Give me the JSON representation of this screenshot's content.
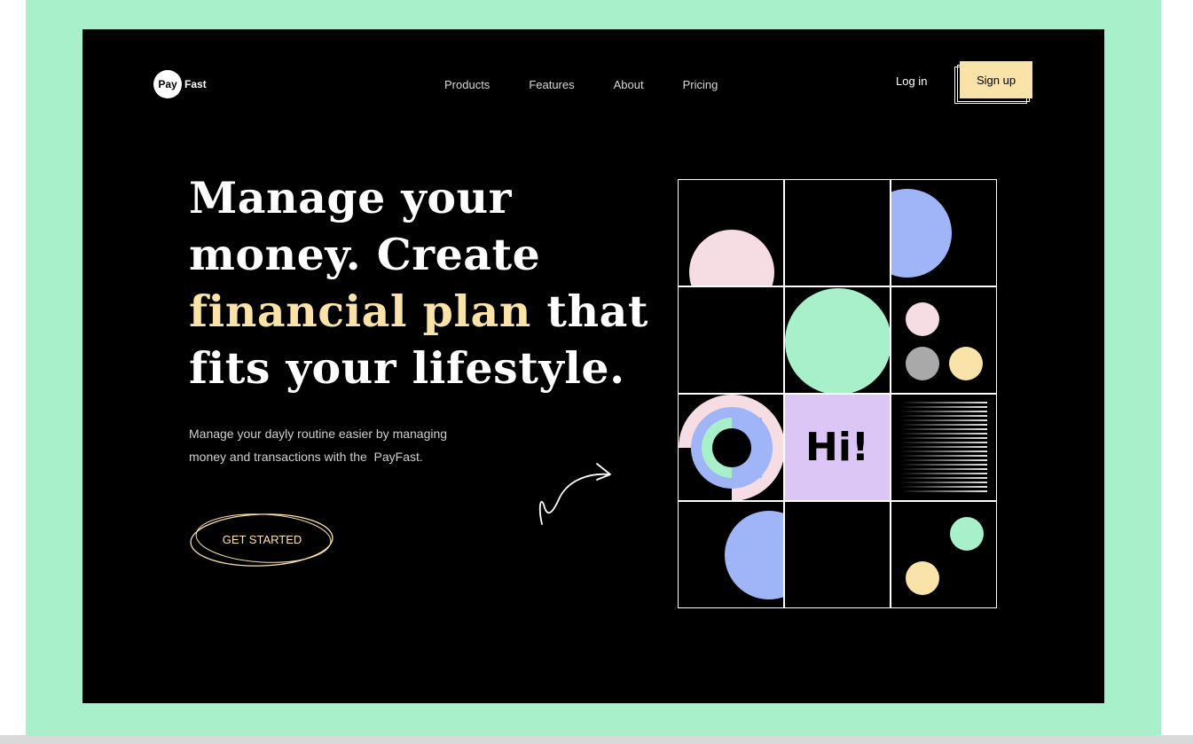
{
  "brand": {
    "logo_mark": "Pay",
    "logo_text": "Fast"
  },
  "nav": {
    "items": [
      "Products",
      "Features",
      "About",
      "Pricing"
    ]
  },
  "auth": {
    "login": "Log in",
    "signup": "Sign up"
  },
  "hero": {
    "line1": "Manage your",
    "line2": "money. Create",
    "line3_highlight": "financial plan",
    "line3_rest": " that",
    "line4": "fits your lifestyle.",
    "subtitle_line1": "Manage your dayly routine easier by managing",
    "subtitle_line2": "money and transactions with the  PayFast.",
    "cta": "GET STARTED"
  },
  "tile": {
    "greeting": "Hi!"
  },
  "colors": {
    "mint": "#a7f0c9",
    "cream": "#f9e3a9",
    "pink": "#f6dde3",
    "blue": "#a0b4f8",
    "lavender": "#dcc6f5",
    "gray": "#a9a9a9"
  },
  "icons": {
    "arrow": "curved-arrow-icon"
  }
}
